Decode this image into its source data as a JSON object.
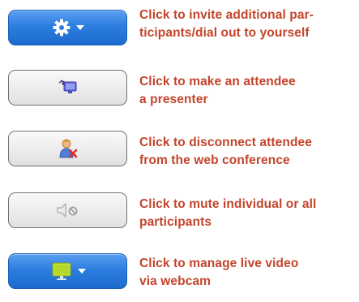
{
  "items": [
    {
      "icon": "gear-icon",
      "line1": "Click to invite additional par-",
      "line2": "ticipants/dial out to yourself"
    },
    {
      "icon": "presenter-icon",
      "line1": "Click to make an attendee",
      "line2": "a presenter"
    },
    {
      "icon": "disconnect-attendee-icon",
      "line1": "Click to disconnect attendee",
      "line2": "from the web conference"
    },
    {
      "icon": "mute-icon",
      "line1": "Click to mute individual or all",
      "line2": "participants"
    },
    {
      "icon": "webcam-video-icon",
      "line1": "Click to manage live video",
      "line2": "via webcam"
    }
  ],
  "colors": {
    "text": "#c4442a",
    "blue_button": "#2d7ee0",
    "gray_button": "#ececec"
  }
}
